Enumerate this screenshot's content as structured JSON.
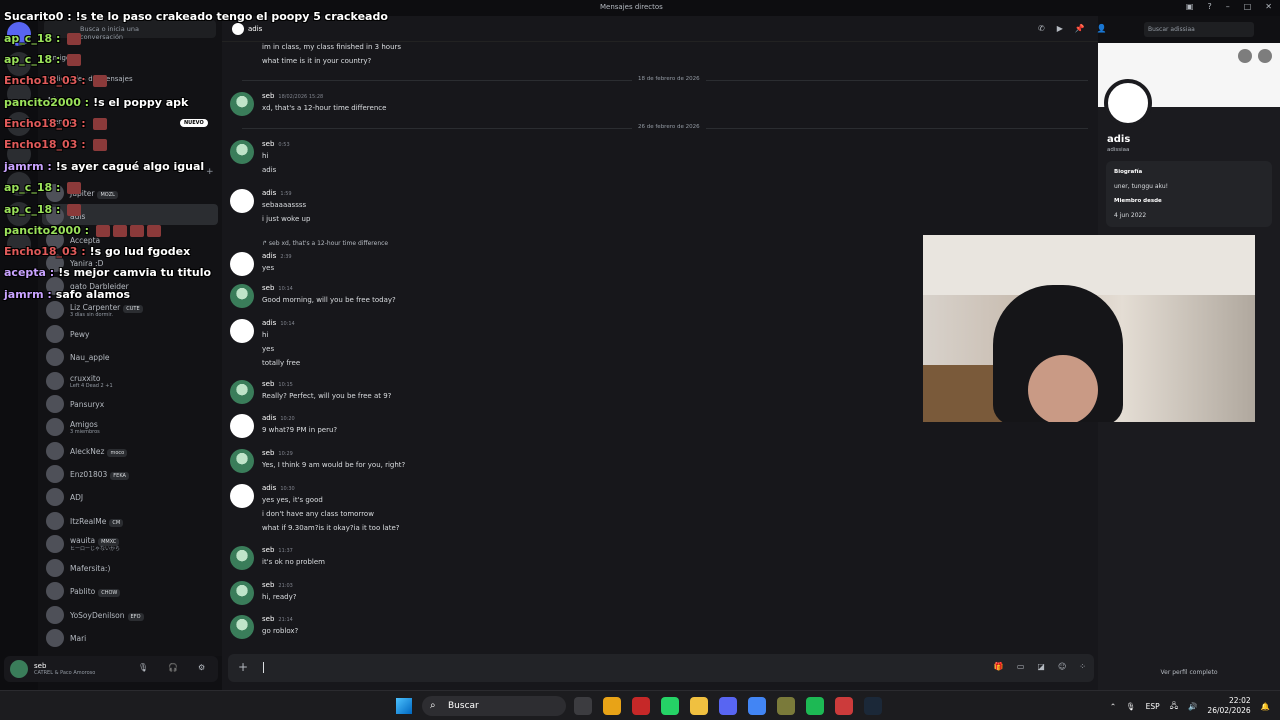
{
  "window": {
    "title": "Mensajes directos"
  },
  "dm_sidebar": {
    "search_placeholder": "Busca o inicia una conversación",
    "nav": [
      "Amigos",
      "Solicitudes de mensajes",
      "Nitro",
      "Tienda"
    ],
    "nav_badge": "NUEVO",
    "friends": [
      {
        "name": "Jupiter",
        "tag": "MOZL",
        "sub": ""
      },
      {
        "name": "adis",
        "tag": "",
        "sub": ""
      },
      {
        "name": "Accepta",
        "tag": "",
        "sub": ""
      },
      {
        "name": "Yanira :D",
        "tag": "",
        "sub": ""
      },
      {
        "name": "gato Darbleider",
        "tag": "",
        "sub": ""
      },
      {
        "name": "Liz Carpenter",
        "tag": "CUTE",
        "sub": "3 días sin dormir."
      },
      {
        "name": "Pewy",
        "tag": "",
        "sub": ""
      },
      {
        "name": "Nau_apple",
        "tag": "",
        "sub": ""
      },
      {
        "name": "cruxxito",
        "tag": "",
        "sub": "Left 4 Dead 2 +1"
      },
      {
        "name": "Pansuryx",
        "tag": "",
        "sub": ""
      },
      {
        "name": "Amigos",
        "tag": "",
        "sub": "3 miembros"
      },
      {
        "name": "AleckNez",
        "tag": "moco",
        "sub": ""
      },
      {
        "name": "Enz01803",
        "tag": "FEKA",
        "sub": ""
      },
      {
        "name": "ADJ",
        "tag": "",
        "sub": ""
      },
      {
        "name": "ItzRealMe",
        "tag": "CM",
        "sub": ""
      },
      {
        "name": "wauita",
        "tag": "MMXC",
        "sub": "ヒーローじゃないから"
      },
      {
        "name": "Mafersita:)",
        "tag": "",
        "sub": ""
      },
      {
        "name": "Pablito",
        "tag": "CHOW",
        "sub": ""
      },
      {
        "name": "YoSoyDenilson",
        "tag": "EFO",
        "sub": ""
      },
      {
        "name": "Mari",
        "tag": "",
        "sub": ""
      }
    ]
  },
  "user_panel": {
    "name": "seb",
    "status": "CATREL & Paco Amoroso"
  },
  "chat": {
    "channel_name": "adis",
    "search_placeholder": "Buscar adissiaa",
    "top_lines": [
      "im in class, my class finished in 3 hours",
      "what time is it in your country?"
    ],
    "dividers": [
      "18 de febrero de 2026",
      "26 de febrero de 2026"
    ],
    "messages": [
      {
        "author": "seb",
        "time": "18/02/2026 15:28",
        "lines": [
          "xd, that's a 12-hour time difference"
        ]
      },
      {
        "author": "seb",
        "time": "0:53",
        "lines": [
          "hi",
          "adis"
        ]
      },
      {
        "author": "adis",
        "time": "1:59",
        "lines": [
          "sebaaaassss",
          "i just woke up"
        ]
      },
      {
        "author": "adis",
        "time": "2:39",
        "reply": "seb xd, that's a 12-hour time difference",
        "lines": [
          "yes"
        ]
      },
      {
        "author": "seb",
        "time": "10:14",
        "lines": [
          "Good morning, will you be free today?"
        ]
      },
      {
        "author": "adis",
        "time": "10:14",
        "lines": [
          "hi",
          "yes",
          "totally free"
        ]
      },
      {
        "author": "seb",
        "time": "10:15",
        "lines": [
          "Really? Perfect, will you be free at 9?"
        ]
      },
      {
        "author": "adis",
        "time": "10:20",
        "lines": [
          "9 what?9 PM in peru?"
        ]
      },
      {
        "author": "seb",
        "time": "10:29",
        "lines": [
          "Yes, I think 9 am would be for you, right?"
        ]
      },
      {
        "author": "adis",
        "time": "10:30",
        "lines": [
          "yes yes, it's good",
          "i don't have any class tomorrow",
          "what if 9.30am?is it okay?ia it too late?"
        ]
      },
      {
        "author": "seb",
        "time": "11:37",
        "lines": [
          "it's ok no problem"
        ]
      },
      {
        "author": "seb",
        "time": "21:03",
        "lines": [
          "hi, ready?"
        ]
      },
      {
        "author": "seb",
        "time": "21:14",
        "lines": [
          "go roblox?"
        ]
      }
    ]
  },
  "profile": {
    "name": "adis",
    "username": "adissiaa",
    "bio_label": "Biografía",
    "bio": "uner, tunggu aku!",
    "member_label": "Miembro desde",
    "member_since": "4 jun 2022",
    "full_profile": "Ver perfil completo"
  },
  "stream_chat": [
    {
      "user": "Sucarito0",
      "color": "#ffffff",
      "text": "!s te lo paso crakeado tengo el poopy 5 crackeado",
      "emotes": 0
    },
    {
      "user": "ap_c_18",
      "color": "#9be25b",
      "text": "",
      "emotes": 1
    },
    {
      "user": "ap_c_18",
      "color": "#9be25b",
      "text": "",
      "emotes": 1
    },
    {
      "user": "Encho18_03",
      "color": "#e05a5a",
      "text": "",
      "emotes": 1
    },
    {
      "user": "pancito2000",
      "color": "#9be25b",
      "text": "!s el poppy apk",
      "emotes": 0
    },
    {
      "user": "Encho18_03",
      "color": "#e05a5a",
      "text": "",
      "emotes": 1
    },
    {
      "user": "Encho18_03",
      "color": "#e05a5a",
      "text": "",
      "emotes": 1
    },
    {
      "user": "jamrm",
      "color": "#c9a3ff",
      "text": "!s ayer cagué algo igual",
      "emotes": 0
    },
    {
      "user": "ap_c_18",
      "color": "#9be25b",
      "text": "",
      "emotes": 1
    },
    {
      "user": "ap_c_18",
      "color": "#9be25b",
      "text": "",
      "emotes": 1
    },
    {
      "user": "pancito2000",
      "color": "#9be25b",
      "text": "",
      "emotes": 4
    },
    {
      "user": "Encho18_03",
      "color": "#e05a5a",
      "text": "!s go lud fgodex",
      "emotes": 0
    },
    {
      "user": "acepta",
      "color": "#c9a3ff",
      "text": "!s mejor camvia tu titulo",
      "emotes": 0
    },
    {
      "user": "jamrm",
      "color": "#c9a3ff",
      "text": "safo alamos",
      "emotes": 0
    }
  ],
  "taskbar": {
    "search": "Buscar",
    "lang": "ESP",
    "time": "22:02",
    "date": "26/02/2026",
    "app_colors": [
      "#3c3c40",
      "#e8a317",
      "#c62828",
      "#25d366",
      "#f0c040",
      "#5865f2",
      "#4285f4",
      "#7a7a3a",
      "#1db954",
      "#cc3b3b",
      "#1b2838"
    ]
  }
}
